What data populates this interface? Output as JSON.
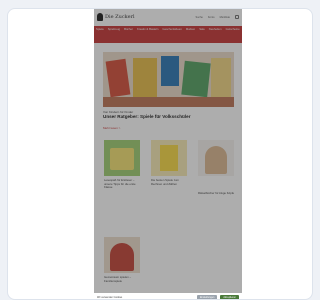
{
  "header": {
    "logo_text": "Die Zuckerl",
    "links": [
      "Suche",
      "Konto",
      "Merkliste"
    ],
    "cart_icon": "cart-icon"
  },
  "nav": {
    "items": [
      "Spiele",
      "Spielzeug",
      "Bücher",
      "Kreativ & Basteln",
      "Geschenkideen",
      "Marken",
      "Sale",
      "Neuheiten",
      "Gutscheine"
    ]
  },
  "hero": {
    "subtitle": "Von Kindern für Kinder",
    "title": "Unser Ratgeber: Spiele für Volksschüler",
    "more_link": "Mehr lesen >"
  },
  "products": [
    {
      "text": "Lesespaß für Erstleser – unsere Tipps für die erste Klasse"
    },
    {
      "text": "Die besten Spiele zum Rechnen und Zählen"
    },
    {
      "text": "Rätselbücher für kluge Köpfe"
    },
    {
      "text": "Gemeinsam spielen – Familienspiele"
    }
  ],
  "cookie": {
    "text": "Wir verwenden Cookies",
    "accept": "Akzeptieren",
    "settings": "Einstellungen"
  },
  "colors": {
    "brand_red": "#c32a2a",
    "overlay": "rgba(60,60,60,0.42)",
    "accept_green": "#4a7a3a"
  }
}
